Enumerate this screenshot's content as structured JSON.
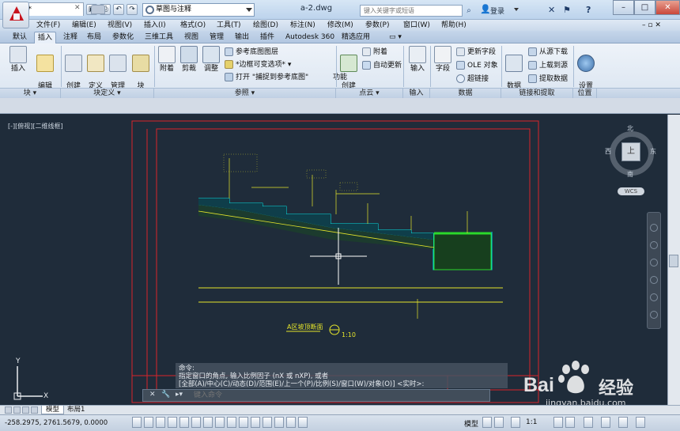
{
  "title_bar": {
    "workspace": "草图与注释",
    "document_title": "a-2.dwg",
    "search_placeholder": "键入关键字或短语",
    "login": "登录",
    "help": "?"
  },
  "menu": [
    "文件(F)",
    "编辑(E)",
    "视图(V)",
    "插入(I)",
    "格式(O)",
    "工具(T)",
    "绘图(D)",
    "标注(N)",
    "修改(M)",
    "参数(P)",
    "窗口(W)",
    "帮助(H)"
  ],
  "ribbon_tabs": [
    "默认",
    "插入",
    "注释",
    "布局",
    "参数化",
    "三维工具",
    "视图",
    "管理",
    "输出",
    "插件",
    "Autodesk 360",
    "精选应用"
  ],
  "active_tab": "插入",
  "ribbon": {
    "insert": "插入",
    "edit_attr": "编辑\n属性",
    "create_block": "创建\n块",
    "define_attr": "定义\n属性",
    "manage_attr": "管理\n属性",
    "block_editor": "块\n编辑器",
    "attach": "附着",
    "clip": "剪裁",
    "adjust": "调整",
    "ref_underlay_layers": "参考底图图层",
    "frame_variable": "*边框可变选项*",
    "snap_to_underlay": "打开 \"捕捉到参考底图\"",
    "features": "功能",
    "create_point_cloud": "创建\n点云",
    "pc_attach": "附着",
    "auto_update": "自动更新",
    "import": "输入",
    "field": "字段",
    "update_fields": "更新字段",
    "ole_object": "OLE 对象",
    "hyperlink": "超链接",
    "data_link": "数据\n链接",
    "download_from_source": "从源下载",
    "upload_to_source": "上载到源",
    "extract_data": "提取数据",
    "set_location": "设置\n位置"
  },
  "panels": [
    "块",
    "块定义",
    "参照",
    "点云",
    "输入",
    "数据",
    "链接和提取",
    "位置"
  ],
  "file_tab": "a-2*",
  "viewport_label": "[-][俯视][二维线框]",
  "viewcube": {
    "north": "北",
    "south": "南",
    "west": "西",
    "east": "东",
    "top": "上",
    "wcs": "WCS"
  },
  "drawing": {
    "caption": "A区坡顶断面",
    "scale": "1:10"
  },
  "command": {
    "line1": "命令:",
    "line2": "指定窗口的角点, 输入比例因子 (nX 或 nXP), 或者",
    "line3": "[全部(A)/中心(C)/动态(D)/范围(E)/上一个(P)/比例(S)/窗口(W)/对象(O)] <实时>:",
    "placeholder": "键入命令"
  },
  "ucs": {
    "x": "X",
    "y": "Y"
  },
  "layout_tabs": [
    "模型",
    "布局1"
  ],
  "status": {
    "coords": "-258.2975,  2761.5679,  0.0000",
    "model": "模型",
    "scale": "1:1"
  },
  "watermark": {
    "brand": "Bai",
    "brand2": "经验",
    "url": "jingyan.baidu.com"
  },
  "colors": {
    "canvas": "#1f2c3a",
    "frame_red": "#d9232b",
    "cyan": "#00e5e5",
    "yellow": "#e5e52b",
    "green": "#2bd92b",
    "autocad_red": "#c8141d"
  }
}
